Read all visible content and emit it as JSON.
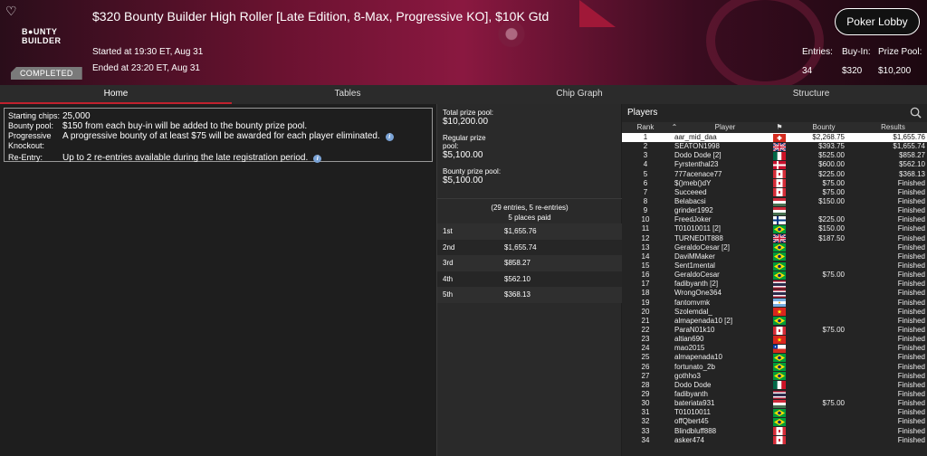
{
  "header": {
    "title": "$320 Bounty Builder High Roller [Late Edition, 8-Max, Progressive KO], $10K Gtd",
    "logo_line1": "B●UNTY",
    "logo_line2": "BUILDER",
    "started": "Started at 19:30 ET, Aug 31",
    "ended": "Ended at 23:20 ET, Aug 31",
    "status": "COMPLETED",
    "lobby_button": "Poker Lobby",
    "entries_label": "Entries:",
    "entries_value": "34",
    "buyin_label": "Buy-In:",
    "buyin_value": "$320",
    "prizepool_label": "Prize Pool:",
    "prizepool_value": "$10,200"
  },
  "tabs": [
    "Home",
    "Tables",
    "Chip Graph",
    "Structure"
  ],
  "info": {
    "chips_label": "Starting chips:",
    "chips_value": "25,000",
    "bounty_label": "Bounty pool:",
    "bounty_value": "$150 from each buy-in will be added to the bounty prize pool.",
    "pko_label": "Progressive Knockout:",
    "pko_value": "A progressive bounty of at least $75 will be awarded for each player eliminated.",
    "reentry_label": "Re-Entry:",
    "reentry_value": "Up to 2 re-entries available during the late registration period."
  },
  "pools": {
    "total_label": "Total prize pool:",
    "total_value": "$10,200.00",
    "regular_label": "Regular prize pool:",
    "regular_value": "$5,100.00",
    "bounty_label": "Bounty prize pool:",
    "bounty_value": "$5,100.00",
    "entries_note": "(29 entries, 5 re-entries)",
    "places_paid": "5 places paid"
  },
  "payouts": [
    {
      "place": "1st",
      "amount": "$1,655.76"
    },
    {
      "place": "2nd",
      "amount": "$1,655.74"
    },
    {
      "place": "3rd",
      "amount": "$858.27"
    },
    {
      "place": "4th",
      "amount": "$562.10"
    },
    {
      "place": "5th",
      "amount": "$368.13"
    }
  ],
  "players_panel": {
    "title": "Players",
    "col_rank": "Rank",
    "col_player": "Player",
    "col_bounty": "Bounty",
    "col_results": "Results"
  },
  "players": [
    {
      "rank": "1",
      "name": "aar_mid_daa",
      "flag": "ch",
      "bounty": "$2,268.75",
      "result": "$1,655.76"
    },
    {
      "rank": "2",
      "name": "SEATON1998",
      "flag": "gb",
      "bounty": "$393.75",
      "result": "$1,655.74"
    },
    {
      "rank": "3",
      "name": "Dodo Dode [2]",
      "flag": "mx",
      "bounty": "$525.00",
      "result": "$858.27"
    },
    {
      "rank": "4",
      "name": "Fyrstenthal23",
      "flag": "dk",
      "bounty": "$600.00",
      "result": "$562.10"
    },
    {
      "rank": "5",
      "name": "777acenace77",
      "flag": "ca",
      "bounty": "$225.00",
      "result": "$368.13"
    },
    {
      "rank": "6",
      "name": "$()meb()dY",
      "flag": "ca",
      "bounty": "$75.00",
      "result": "Finished"
    },
    {
      "rank": "7",
      "name": "Succeeed",
      "flag": "ca",
      "bounty": "$75.00",
      "result": "Finished"
    },
    {
      "rank": "8",
      "name": "Belabacsi",
      "flag": "hu",
      "bounty": "$150.00",
      "result": "Finished"
    },
    {
      "rank": "9",
      "name": "grinder1992",
      "flag": "hu",
      "bounty": "",
      "result": "Finished"
    },
    {
      "rank": "10",
      "name": "FreedJoker",
      "flag": "fi",
      "bounty": "$225.00",
      "result": "Finished"
    },
    {
      "rank": "11",
      "name": "T01010011 [2]",
      "flag": "br",
      "bounty": "$150.00",
      "result": "Finished"
    },
    {
      "rank": "12",
      "name": "TURNEDIT888",
      "flag": "gb",
      "bounty": "$187.50",
      "result": "Finished"
    },
    {
      "rank": "13",
      "name": "GeraldoCesar [2]",
      "flag": "br",
      "bounty": "",
      "result": "Finished"
    },
    {
      "rank": "14",
      "name": "DaviMMaker",
      "flag": "br",
      "bounty": "",
      "result": "Finished"
    },
    {
      "rank": "15",
      "name": "Sent1mental",
      "flag": "br",
      "bounty": "",
      "result": "Finished"
    },
    {
      "rank": "16",
      "name": "GeraldoCesar",
      "flag": "br",
      "bounty": "$75.00",
      "result": "Finished"
    },
    {
      "rank": "17",
      "name": "fadibyanth [2]",
      "flag": "th",
      "bounty": "",
      "result": "Finished"
    },
    {
      "rank": "18",
      "name": "WrongOne364",
      "flag": "th",
      "bounty": "",
      "result": "Finished"
    },
    {
      "rank": "19",
      "name": "fantomvmk",
      "flag": "ar",
      "bounty": "",
      "result": "Finished"
    },
    {
      "rank": "20",
      "name": "Szolemdal_",
      "flag": "vn",
      "bounty": "",
      "result": "Finished"
    },
    {
      "rank": "21",
      "name": "almapenada10 [2]",
      "flag": "br",
      "bounty": "",
      "result": "Finished"
    },
    {
      "rank": "22",
      "name": "ParaN01k10",
      "flag": "ca",
      "bounty": "$75.00",
      "result": "Finished"
    },
    {
      "rank": "23",
      "name": "altian690",
      "flag": "vn",
      "bounty": "",
      "result": "Finished"
    },
    {
      "rank": "24",
      "name": "mao2015",
      "flag": "cl",
      "bounty": "",
      "result": "Finished"
    },
    {
      "rank": "25",
      "name": "almapenada10",
      "flag": "br",
      "bounty": "",
      "result": "Finished"
    },
    {
      "rank": "26",
      "name": "fortunato_2b",
      "flag": "br",
      "bounty": "",
      "result": "Finished"
    },
    {
      "rank": "27",
      "name": "gothho3",
      "flag": "br",
      "bounty": "",
      "result": "Finished"
    },
    {
      "rank": "28",
      "name": "Dodo Dode",
      "flag": "mx",
      "bounty": "",
      "result": "Finished"
    },
    {
      "rank": "29",
      "name": "fadibyanth",
      "flag": "th",
      "bounty": "",
      "result": "Finished"
    },
    {
      "rank": "30",
      "name": "bateriata931",
      "flag": "hu",
      "bounty": "$75.00",
      "result": "Finished"
    },
    {
      "rank": "31",
      "name": "T01010011",
      "flag": "br",
      "bounty": "",
      "result": "Finished"
    },
    {
      "rank": "32",
      "name": "offQbert45",
      "flag": "br",
      "bounty": "",
      "result": "Finished"
    },
    {
      "rank": "33",
      "name": "Blindbluff888",
      "flag": "ca",
      "bounty": "",
      "result": "Finished"
    },
    {
      "rank": "34",
      "name": "asker474",
      "flag": "ca",
      "bounty": "",
      "result": "Finished"
    }
  ],
  "colors": {
    "accent": "#c0212e",
    "header_mid": "#8a1840",
    "panel_bg": "#242424"
  }
}
